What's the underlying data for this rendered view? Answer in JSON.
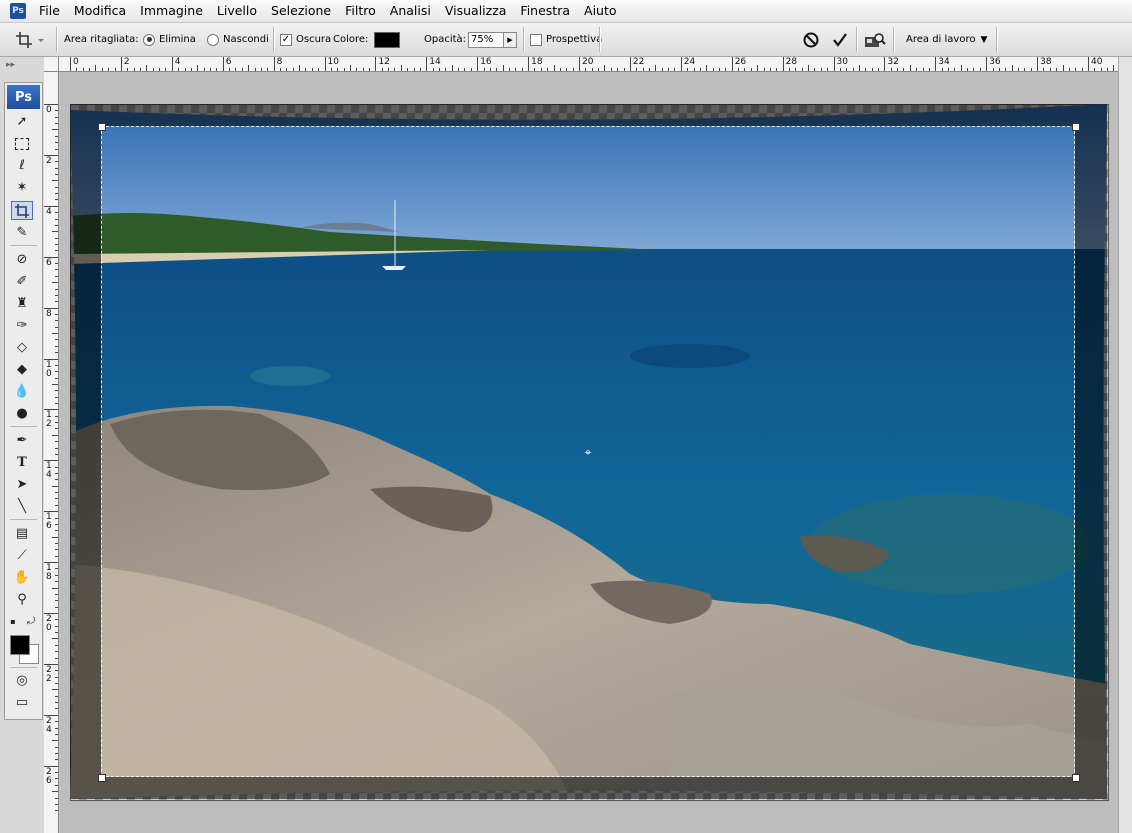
{
  "app": {
    "icon_label": "Ps",
    "logo_label": "Ps"
  },
  "menu": {
    "items": [
      {
        "label": "File"
      },
      {
        "label": "Modifica"
      },
      {
        "label": "Immagine"
      },
      {
        "label": "Livello"
      },
      {
        "label": "Selezione"
      },
      {
        "label": "Filtro"
      },
      {
        "label": "Analisi"
      },
      {
        "label": "Visualizza"
      },
      {
        "label": "Finestra"
      },
      {
        "label": "Aiuto"
      }
    ]
  },
  "options": {
    "crop_area_label": "Area ritagliata:",
    "delete_label": "Elimina",
    "hide_label": "Nascondi",
    "delete_selected": true,
    "shield_label": "Oscura",
    "shield_checked": true,
    "color_label": "Colore:",
    "shield_color": "#000000",
    "opacity_label": "Opacità:",
    "opacity_value": "75%",
    "perspective_label": "Prospettiva",
    "perspective_checked": false,
    "workspace_label": "Area di lavoro"
  },
  "tools": {
    "active": "crop-tool",
    "foreground_color": "#000000",
    "background_color": "#ffffff"
  },
  "ruler": {
    "h_labels": [
      "0",
      "2",
      "4",
      "6",
      "8",
      "10",
      "12",
      "14",
      "16",
      "18",
      "20",
      "22",
      "24",
      "26",
      "28",
      "30",
      "32",
      "34",
      "36",
      "38",
      "40"
    ],
    "v_labels": [
      "0",
      "2",
      "4",
      "6",
      "8",
      "10",
      "12",
      "14",
      "16",
      "18",
      "20",
      "22",
      "24",
      "26"
    ]
  },
  "icons": {
    "cancel": "cancel-icon",
    "commit": "commit-check-icon",
    "bridge": "bridge-icon"
  }
}
